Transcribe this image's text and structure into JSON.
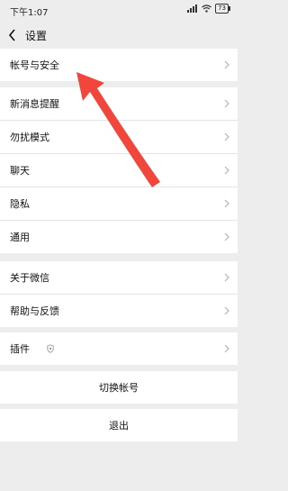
{
  "status_bar": {
    "time": "下午1:07",
    "battery": "73"
  },
  "nav": {
    "title": "设置"
  },
  "groups": [
    {
      "items": [
        {
          "label": "帐号与安全"
        }
      ]
    },
    {
      "items": [
        {
          "label": "新消息提醒"
        },
        {
          "label": "勿扰模式"
        },
        {
          "label": "聊天"
        },
        {
          "label": "隐私"
        },
        {
          "label": "通用"
        }
      ]
    },
    {
      "items": [
        {
          "label": "关于微信"
        },
        {
          "label": "帮助与反馈"
        }
      ]
    },
    {
      "items": [
        {
          "label": "插件"
        }
      ]
    }
  ],
  "actions": {
    "switch_account": "切换帐号",
    "logout": "退出"
  },
  "colors": {
    "annotation_arrow": "#f0463c"
  }
}
